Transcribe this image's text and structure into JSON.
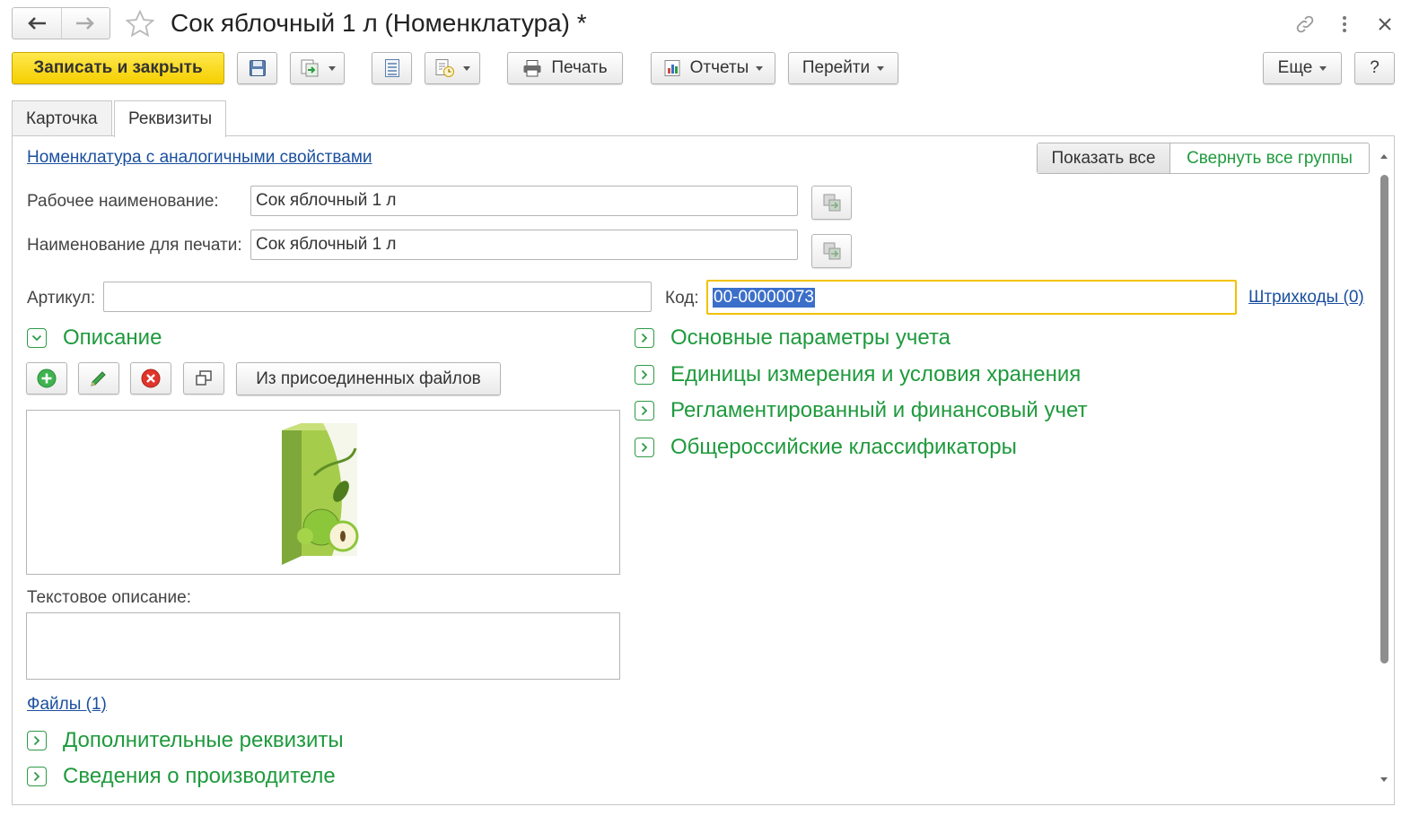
{
  "window": {
    "title": "Сок яблочный 1 л (Номенклатура) *",
    "icons": [
      "back-arrow-icon",
      "forward-arrow-icon",
      "favorite-star-icon",
      "link-icon",
      "more-vertical-icon",
      "close-icon"
    ]
  },
  "toolbar": {
    "save_close_label": "Записать и закрыть",
    "print_label": "Печать",
    "reports_label": "Отчеты",
    "goto_label": "Перейти",
    "more_label": "Еще",
    "help_label": "?"
  },
  "tabs": [
    {
      "label": "Карточка",
      "active": false
    },
    {
      "label": "Реквизиты",
      "active": true
    }
  ],
  "form": {
    "similar_link": "Номенклатура с аналогичными свойствами",
    "show_all_label": "Показать все",
    "collapse_all_label": "Свернуть все группы",
    "work_name_label": "Рабочее наименование:",
    "work_name_value": "Сок яблочный 1 л",
    "print_name_label": "Наименование для печати:",
    "print_name_value": "Сок яблочный 1 л",
    "article_label": "Артикул:",
    "article_value": "",
    "code_label": "Код:",
    "code_value": "00-00000073",
    "barcodes_link": "Штрихкоды (0)",
    "description_group": "Описание",
    "from_files_label": "Из присоединенных файлов",
    "text_description_label": "Текстовое описание:",
    "text_description_value": "",
    "files_link": "Файлы (1)",
    "additional_group": "Дополнительные реквизиты",
    "manufacturer_group": "Сведения о производителе",
    "right_groups": [
      "Основные параметры учета",
      "Единицы измерения и условия хранения",
      "Регламентированный и финансовый учет",
      "Общероссийские классификаторы"
    ]
  },
  "colors": {
    "accent_yellow": "#f5cf00",
    "group_green": "#1f9a3d",
    "link_blue": "#1a4f9e",
    "selection_blue": "#3b6fc9"
  }
}
